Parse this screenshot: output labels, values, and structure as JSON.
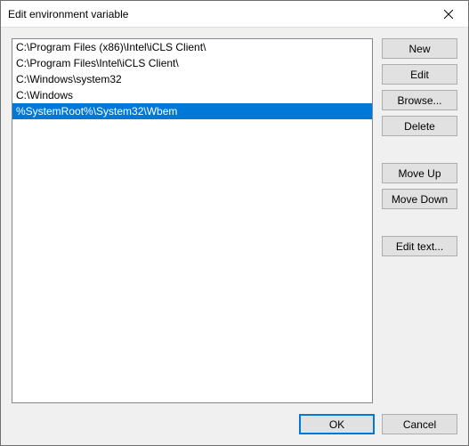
{
  "window": {
    "title": "Edit environment variable"
  },
  "list": {
    "items": [
      {
        "text": "C:\\Program Files (x86)\\Intel\\iCLS Client\\",
        "selected": false
      },
      {
        "text": "C:\\Program Files\\Intel\\iCLS Client\\",
        "selected": false
      },
      {
        "text": "C:\\Windows\\system32",
        "selected": false
      },
      {
        "text": "C:\\Windows",
        "selected": false
      },
      {
        "text": "%SystemRoot%\\System32\\Wbem",
        "selected": true
      }
    ]
  },
  "buttons": {
    "new": "New",
    "edit": "Edit",
    "browse": "Browse...",
    "delete": "Delete",
    "move_up": "Move Up",
    "move_down": "Move Down",
    "edit_text": "Edit text...",
    "ok": "OK",
    "cancel": "Cancel"
  }
}
